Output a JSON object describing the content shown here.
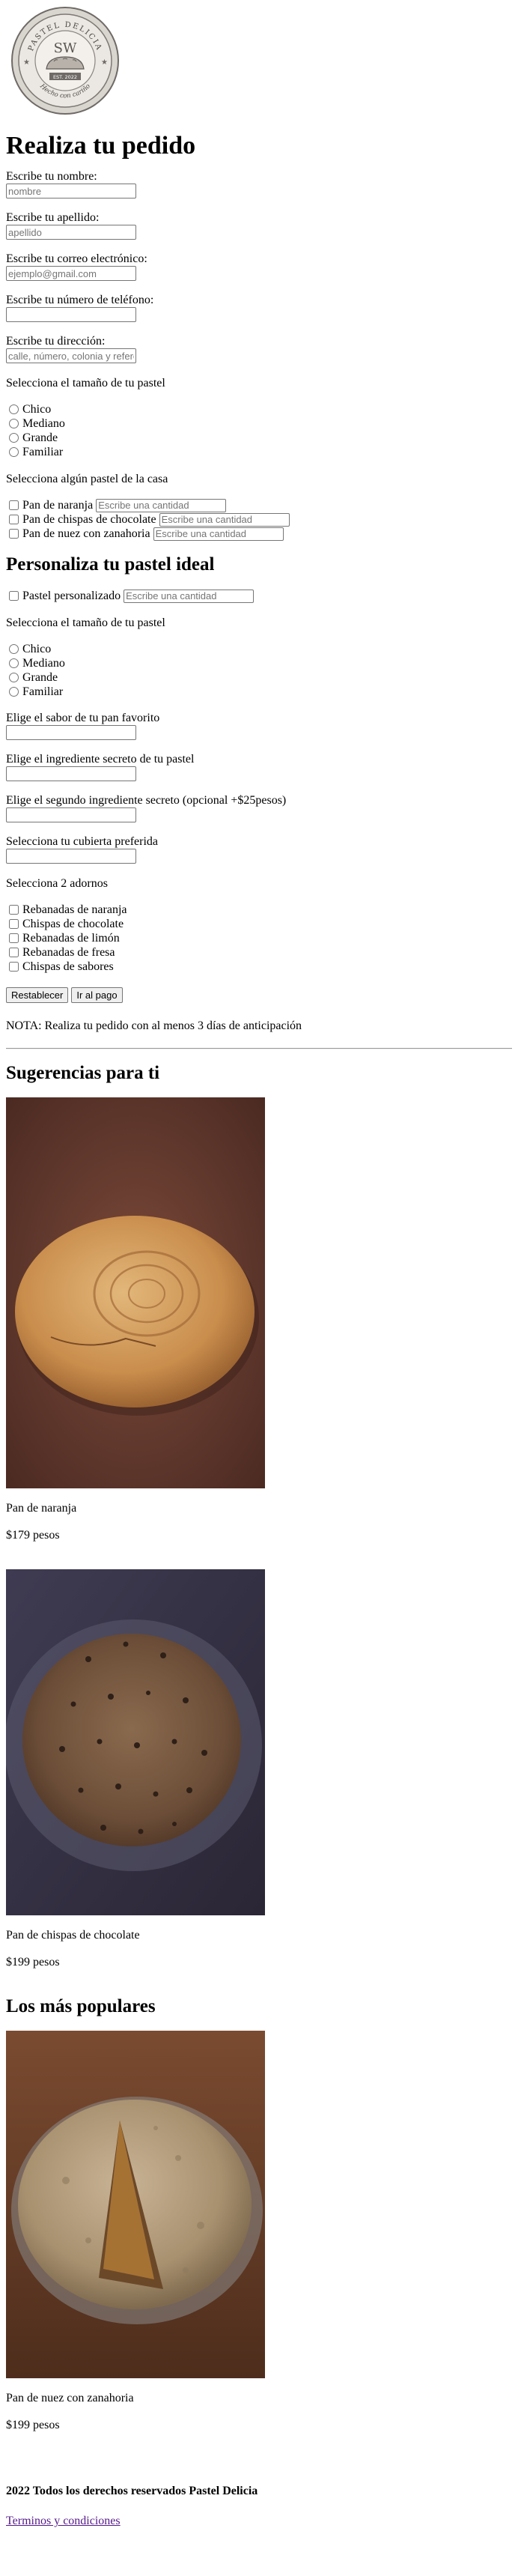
{
  "logo": {
    "top_text": "PASTEL DELICIA",
    "monogram": "SW",
    "est": "EST. 2022",
    "bottom_text": "Hecho con cariño"
  },
  "order": {
    "title": "Realiza tu pedido",
    "name_label": "Escribe tu nombre:",
    "name_placeholder": "nombre",
    "lastname_label": "Escribe tu apellido:",
    "lastname_placeholder": "apellido",
    "email_label": "Escribe tu correo electrónico:",
    "email_placeholder": "ejemplo@gmail.com",
    "phone_label": "Escribe tu número de teléfono:",
    "phone_placeholder": "",
    "address_label": "Escribe tu dirección:",
    "address_placeholder": "calle, número, colonia y referencias",
    "size_label": "Selecciona el tamaño de tu pastel",
    "sizes": [
      "Chico",
      "Mediano",
      "Grande",
      "Familiar"
    ],
    "house_label": "Selecciona algún pastel de la casa",
    "house_items": [
      "Pan de naranja",
      "Pan de chispas de chocolate",
      "Pan de nuez con zanahoria"
    ],
    "qty_placeholder": "Escribe una cantidad"
  },
  "custom": {
    "title": "Personaliza tu pastel ideal",
    "custom_item": "Pastel personalizado",
    "qty_placeholder": "Escribe una cantidad",
    "size_label": "Selecciona el tamaño de tu pastel",
    "sizes": [
      "Chico",
      "Mediano",
      "Grande",
      "Familiar"
    ],
    "flavor_label": "Elige el sabor de tu pan favorito",
    "secret_label": "Elige el ingrediente secreto de tu pastel",
    "secret2_label": "Elige el segundo ingrediente secreto (opcional +$25pesos)",
    "cover_label": "Selecciona tu cubierta preferida",
    "decor_label": "Selecciona 2 adornos",
    "decor_items": [
      "Rebanadas de naranja",
      "Chispas de chocolate",
      "Rebanadas de limón",
      "Rebanadas de fresa",
      "Chispas de sabores"
    ],
    "reset_label": "Restablecer",
    "pay_label": "Ir al pago",
    "note": "NOTA: Realiza tu pedido con al menos 3 días de anticipación"
  },
  "suggestions": {
    "title": "Sugerencias para ti",
    "items": [
      {
        "name": "Pan de naranja",
        "price": "$179 pesos"
      },
      {
        "name": "Pan de chispas de chocolate",
        "price": "$199 pesos"
      }
    ]
  },
  "popular": {
    "title": "Los más populares",
    "items": [
      {
        "name": "Pan de nuez con zanahoria",
        "price": "$199 pesos"
      }
    ]
  },
  "footer": {
    "copyright": "2022 Todos los derechos reservados Pastel Delicia",
    "terms_link": "Terminos y condiciones"
  },
  "colors": {
    "link": "#551a8b",
    "logo_ring": "#8a8580",
    "logo_fill": "#e9e5e0"
  }
}
